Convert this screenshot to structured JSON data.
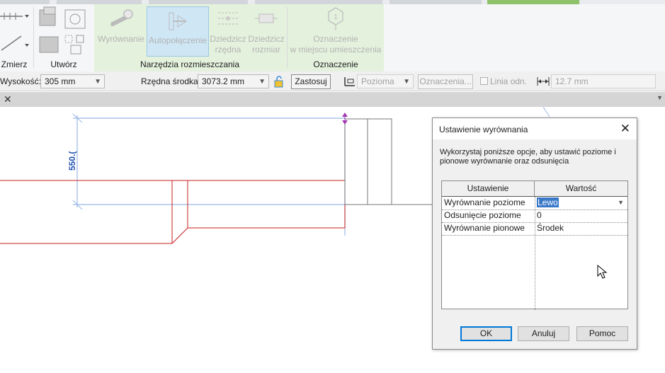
{
  "ribbon": {
    "left_panels": {
      "measure_label": "Zmierz",
      "create_label": "Utwórz"
    },
    "placement_tools": {
      "panel_label": "Narzędzia rozmieszczania",
      "buttons": [
        {
          "line1": "Wyrównanie",
          "line2": ""
        },
        {
          "line1": "Autopołączenie",
          "line2": ""
        },
        {
          "line1": "Dziedzicz",
          "line2": "rzędna"
        },
        {
          "line1": "Dziedzicz",
          "line2": "rozmiar"
        }
      ]
    },
    "tagging": {
      "panel_label": "Oznaczenie",
      "button_line1": "Oznaczenie",
      "button_line2": "w miejscu umieszczenia"
    }
  },
  "options_bar": {
    "height_label": "Wysokość:",
    "height_value": "305 mm",
    "center_elevation_label": "Rzędna środka:",
    "center_elevation_value": "3073.2 mm",
    "apply_button": "Zastosuj",
    "orientation_value": "Pozioma",
    "tags_button": "Oznaczenia...",
    "leader_label": "Linia odn.",
    "leader_length_value": "12.7 mm"
  },
  "canvas": {
    "dimension_text": "550.("
  },
  "dialog": {
    "title": "Ustawienie wyrównania",
    "description": "Wykorzystaj poniższe opcje, aby ustawić poziome i pionowe wyrównanie oraz odsunięcia",
    "columns": [
      "Ustawienie",
      "Wartość"
    ],
    "rows": [
      {
        "setting": "Wyrównanie poziome",
        "value": "Lewo"
      },
      {
        "setting": "Odsunięcie poziome",
        "value": "0"
      },
      {
        "setting": "Wyrównanie pionowe",
        "value": "Środek"
      }
    ],
    "buttons": {
      "ok": "OK",
      "cancel": "Anuluj",
      "help": "Pomoc"
    }
  }
}
